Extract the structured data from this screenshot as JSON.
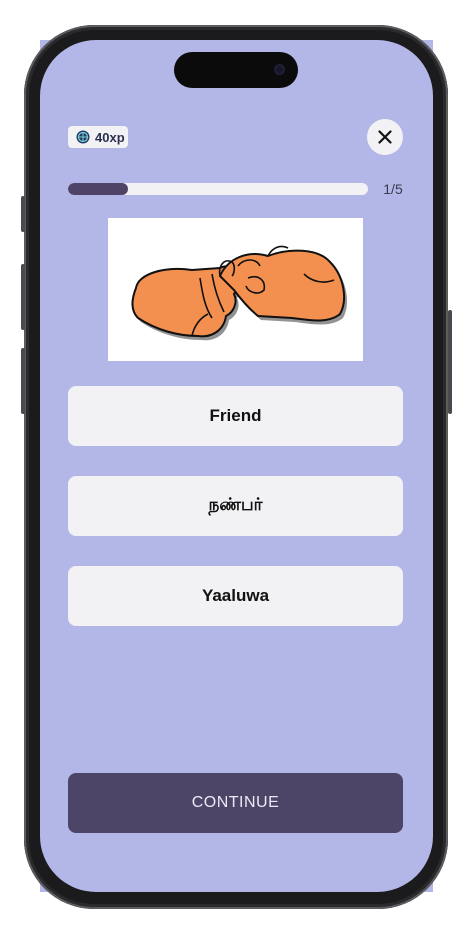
{
  "header": {
    "xp_label": "40xp",
    "xp_icon": "globe-badge-icon",
    "close_icon": "close-icon"
  },
  "progress": {
    "current": 1,
    "total": 5,
    "fraction": 0.2,
    "label": "1/5"
  },
  "prompt_image": {
    "description_icon": "hand-sign-icon"
  },
  "options": [
    {
      "label": "Friend"
    },
    {
      "label": "நண்பர்"
    },
    {
      "label": "Yaaluwa"
    }
  ],
  "footer": {
    "continue_label": "CONTINUE"
  },
  "colors": {
    "screen_bg": "#b2b7e8",
    "card_bg": "#f2f2f5",
    "accent": "#4d4568",
    "hand_fill": "#f4904f"
  }
}
